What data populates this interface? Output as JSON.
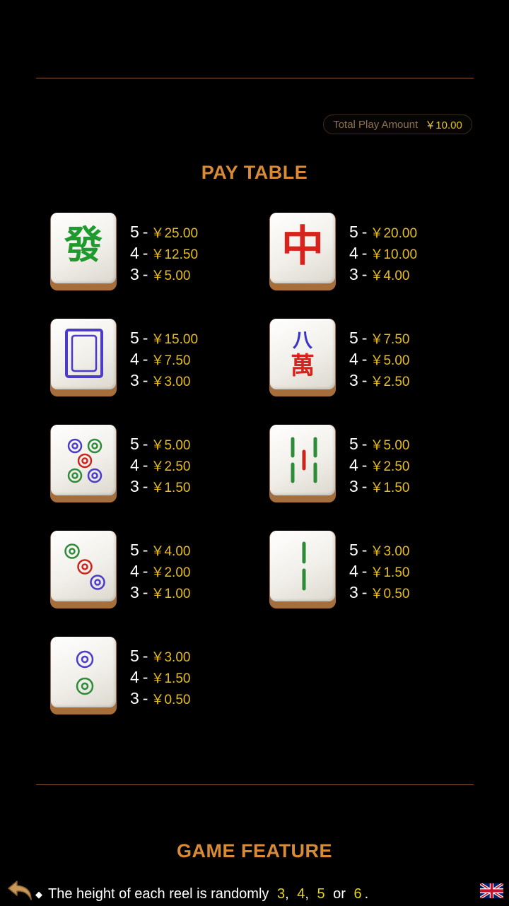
{
  "header": {
    "total_play_label": "Total Play Amount",
    "total_play_value": "￥10.00"
  },
  "paytable": {
    "title": "PAY TABLE",
    "items": [
      {
        "symbol": "green-dragon-fa-tile",
        "rows": [
          {
            "count": "5",
            "amount": "￥25.00"
          },
          {
            "count": "4",
            "amount": "￥12.50"
          },
          {
            "count": "3",
            "amount": "￥5.00"
          }
        ]
      },
      {
        "symbol": "red-dragon-zhong-tile",
        "rows": [
          {
            "count": "5",
            "amount": "￥20.00"
          },
          {
            "count": "4",
            "amount": "￥10.00"
          },
          {
            "count": "3",
            "amount": "￥4.00"
          }
        ]
      },
      {
        "symbol": "white-dragon-tile",
        "rows": [
          {
            "count": "5",
            "amount": "￥15.00"
          },
          {
            "count": "4",
            "amount": "￥7.50"
          },
          {
            "count": "3",
            "amount": "￥3.00"
          }
        ]
      },
      {
        "symbol": "eight-wan-tile",
        "rows": [
          {
            "count": "5",
            "amount": "￥7.50"
          },
          {
            "count": "4",
            "amount": "￥5.00"
          },
          {
            "count": "3",
            "amount": "￥2.50"
          }
        ]
      },
      {
        "symbol": "five-dots-tile",
        "rows": [
          {
            "count": "5",
            "amount": "￥5.00"
          },
          {
            "count": "4",
            "amount": "￥2.50"
          },
          {
            "count": "3",
            "amount": "￥1.50"
          }
        ]
      },
      {
        "symbol": "five-bamboo-tile",
        "rows": [
          {
            "count": "5",
            "amount": "￥5.00"
          },
          {
            "count": "4",
            "amount": "￥2.50"
          },
          {
            "count": "3",
            "amount": "￥1.50"
          }
        ]
      },
      {
        "symbol": "three-dots-tile",
        "rows": [
          {
            "count": "5",
            "amount": "￥4.00"
          },
          {
            "count": "4",
            "amount": "￥2.00"
          },
          {
            "count": "3",
            "amount": "￥1.00"
          }
        ]
      },
      {
        "symbol": "two-bamboo-tile",
        "rows": [
          {
            "count": "5",
            "amount": "￥3.00"
          },
          {
            "count": "4",
            "amount": "￥1.50"
          },
          {
            "count": "3",
            "amount": "￥0.50"
          }
        ]
      },
      {
        "symbol": "two-dots-tile",
        "rows": [
          {
            "count": "5",
            "amount": "￥3.00"
          },
          {
            "count": "4",
            "amount": "￥1.50"
          },
          {
            "count": "3",
            "amount": "￥0.50"
          }
        ]
      }
    ]
  },
  "feature": {
    "title": "GAME FEATURE",
    "line_text": "The height of each reel is randomly",
    "values": [
      "3",
      "4",
      "5",
      "6"
    ],
    "sep": ",",
    "or_word": "or",
    "end": "."
  },
  "colors": {
    "title": "#d98a34",
    "amount": "#e6bf1f",
    "divider": "#8a5a33",
    "background": "#000000"
  },
  "icons": {
    "back": "back-arrow-icon",
    "language": "uk-flag-icon"
  }
}
